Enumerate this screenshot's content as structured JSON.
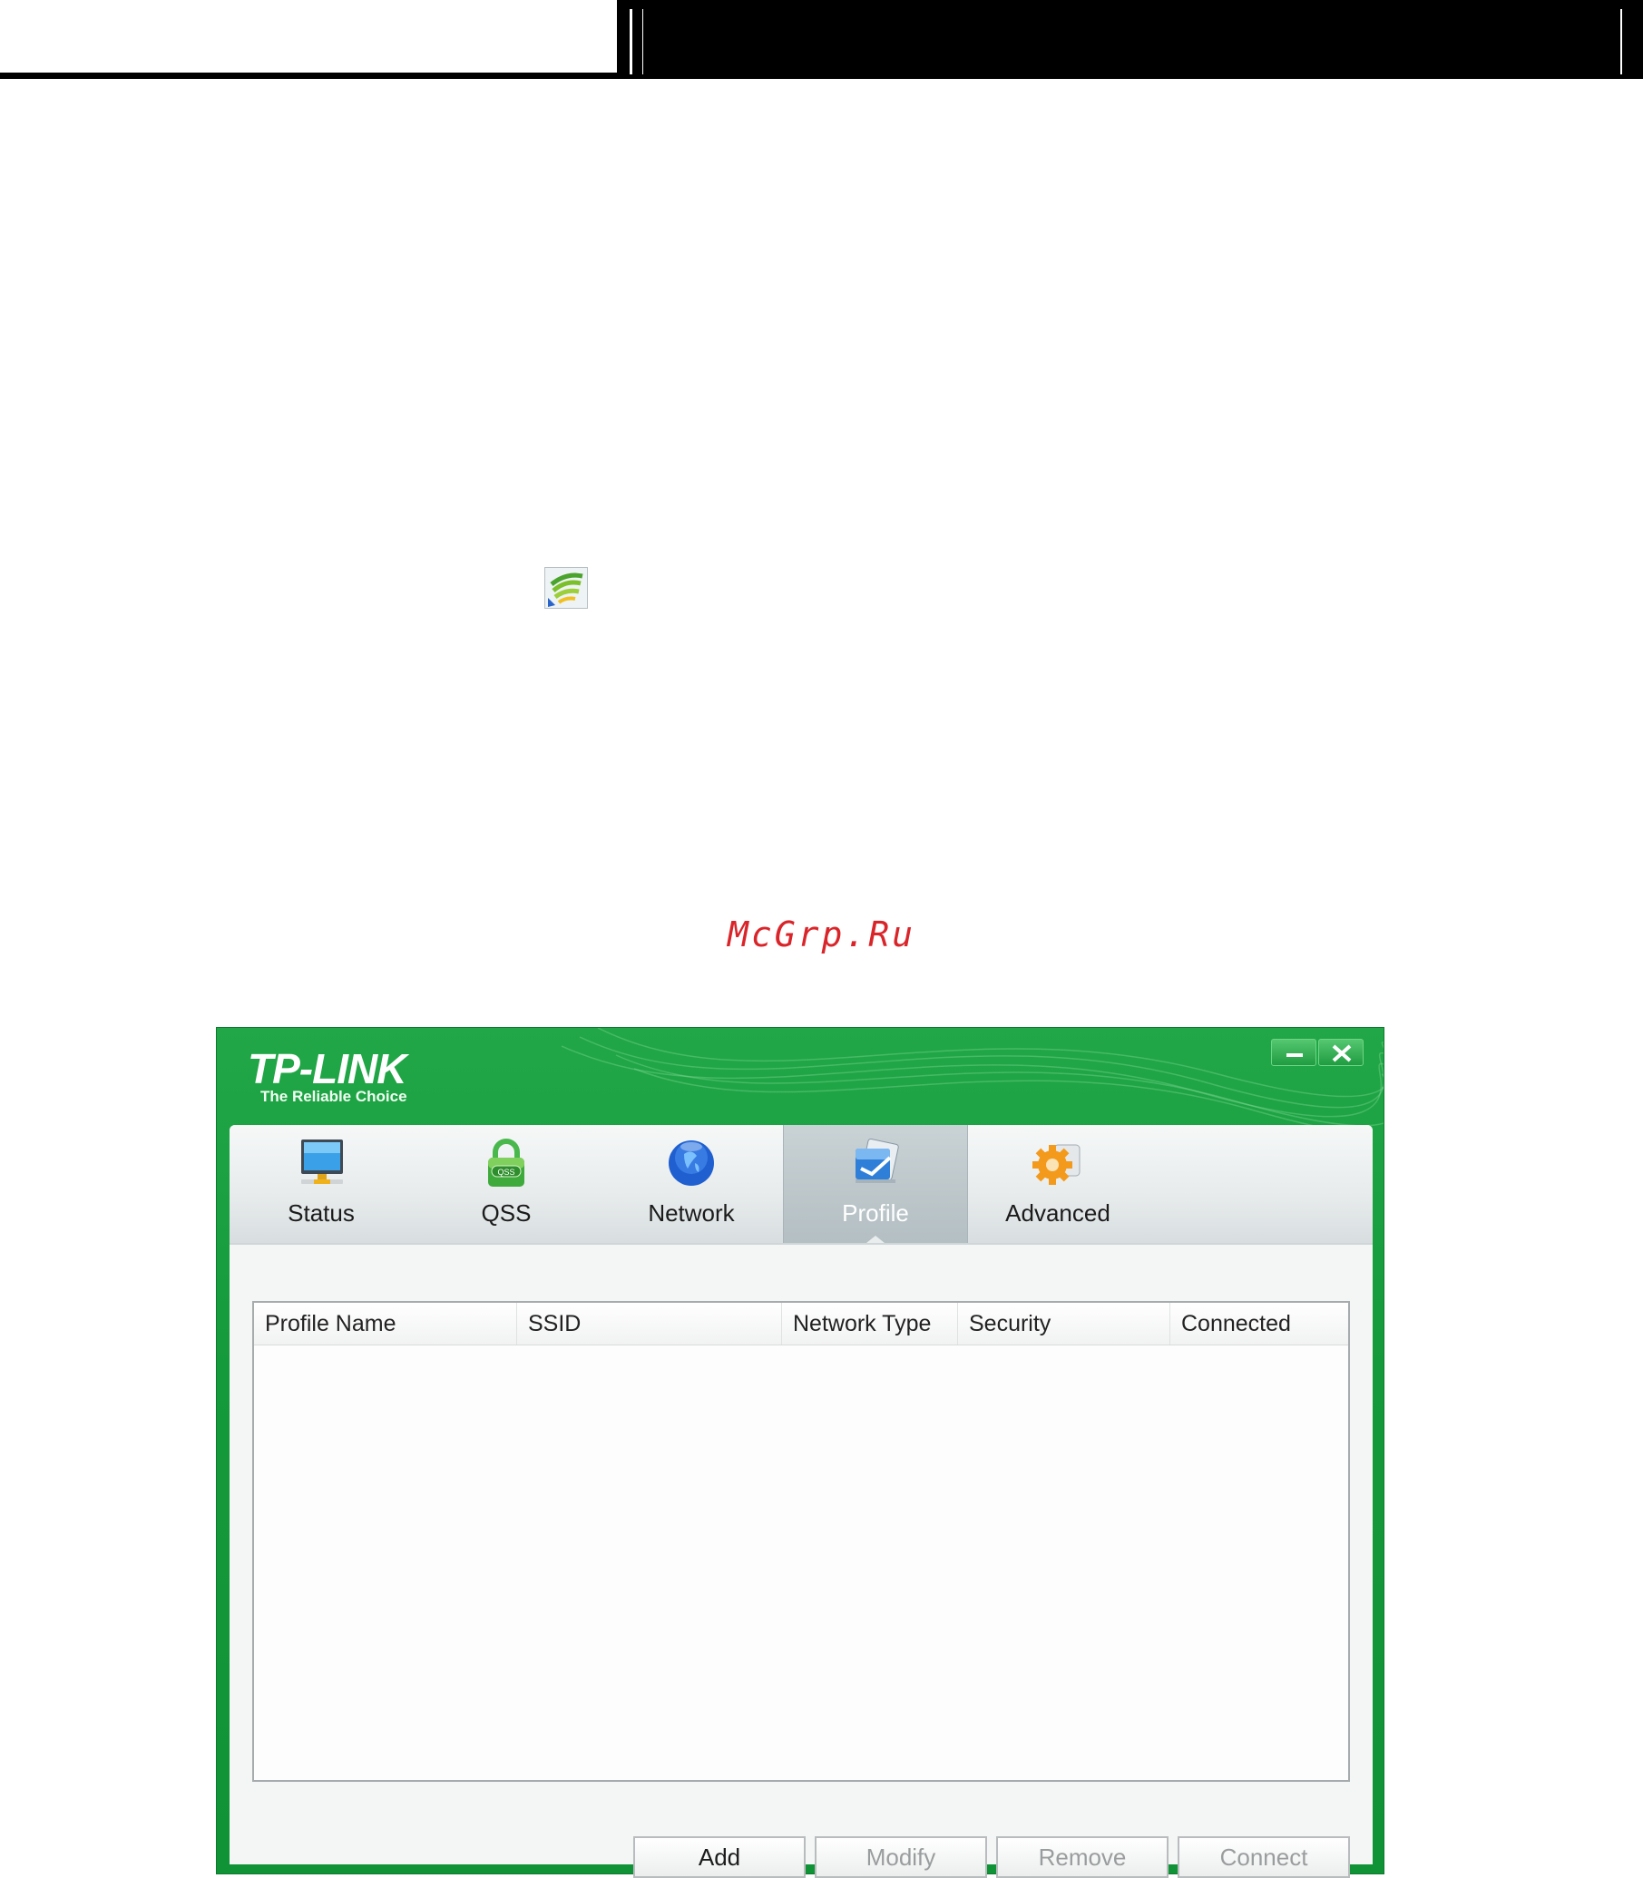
{
  "watermark": "McGrp.Ru",
  "app": {
    "logo": "TP-LINK",
    "tagline": "The Reliable Choice",
    "tabs": [
      {
        "label": "Status",
        "icon": "monitor-icon",
        "active": false
      },
      {
        "label": "QSS",
        "icon": "qss-lock-icon",
        "active": false
      },
      {
        "label": "Network",
        "icon": "globe-icon",
        "active": false
      },
      {
        "label": "Profile",
        "icon": "profile-icon",
        "active": true
      },
      {
        "label": "Advanced",
        "icon": "gear-icon",
        "active": false
      }
    ],
    "table": {
      "columns": [
        "Profile Name",
        "SSID",
        "Network Type",
        "Security",
        "Connected"
      ],
      "rows": []
    },
    "buttons": {
      "add": "Add",
      "modify": "Modify",
      "remove": "Remove",
      "connect": "Connect"
    }
  },
  "colors": {
    "brand_green": "#1a9f40",
    "watermark_red": "#d9252a"
  }
}
